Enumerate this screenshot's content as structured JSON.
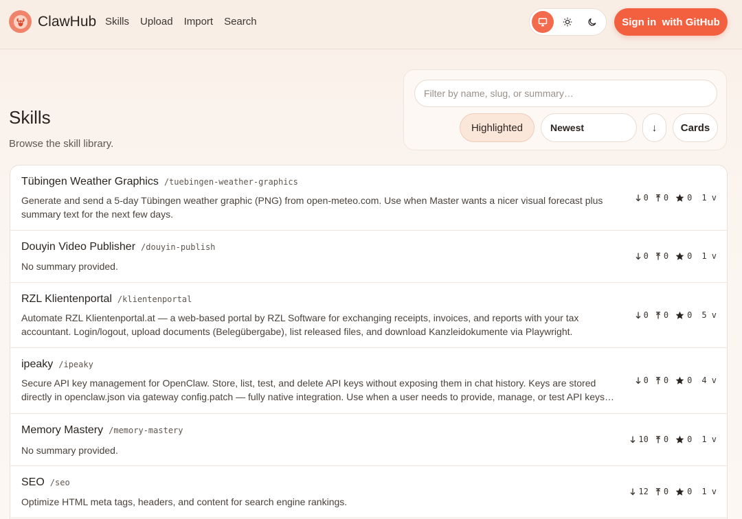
{
  "header": {
    "brand": "ClawHub",
    "nav": [
      "Skills",
      "Upload",
      "Import",
      "Search"
    ],
    "signin_label": "Sign in  with GitHub",
    "theme_options": [
      "system",
      "light",
      "dark"
    ],
    "active_theme": "system",
    "accent": "#f2603f"
  },
  "page": {
    "title": "Skills",
    "subtitle": "Browse the skill library."
  },
  "filters": {
    "placeholder": "Filter by name, slug, or summary…",
    "highlighted_label": "Highlighted",
    "sort_label": "Newest",
    "direction_label": "↓",
    "view_label": "Cards"
  },
  "skills": [
    {
      "name": "Tübingen Weather Graphics",
      "slug": "/tuebingen-weather-graphics",
      "summary": "Generate and send a 5-day Tübingen weather graphic (PNG) from open-meteo.com. Use when Master wants a nicer visual forecast plus summary text for the next few days.",
      "downloads": "0",
      "installs": "0",
      "stars": "0",
      "versions": "1 v"
    },
    {
      "name": "Douyin Video Publisher",
      "slug": "/douyin-publish",
      "summary": "No summary provided.",
      "downloads": "0",
      "installs": "0",
      "stars": "0",
      "versions": "1 v"
    },
    {
      "name": "RZL Klientenportal",
      "slug": "/klientenportal",
      "summary": "Automate RZL Klientenportal.at — a web-based portal by RZL Software for exchanging receipts, invoices, and reports with your tax accountant. Login/logout, upload documents (Belegübergabe), list released files, and download Kanzleidokumente via Playwright.",
      "downloads": "0",
      "installs": "0",
      "stars": "0",
      "versions": "5 v"
    },
    {
      "name": "ipeaky",
      "slug": "/ipeaky",
      "summary": "Secure API key management for OpenClaw. Store, list, test, and delete API keys without exposing them in chat history. Keys are stored directly in openclaw.json via gateway config.patch — fully native integration. Use when a user needs to provide, manage, or test API keys…",
      "downloads": "0",
      "installs": "0",
      "stars": "0",
      "versions": "4 v"
    },
    {
      "name": "Memory Mastery",
      "slug": "/memory-mastery",
      "summary": "No summary provided.",
      "downloads": "10",
      "installs": "0",
      "stars": "0",
      "versions": "1 v"
    },
    {
      "name": "SEO",
      "slug": "/seo",
      "summary": "Optimize HTML meta tags, headers, and content for search engine rankings.",
      "downloads": "12",
      "installs": "0",
      "stars": "0",
      "versions": "1 v"
    }
  ]
}
